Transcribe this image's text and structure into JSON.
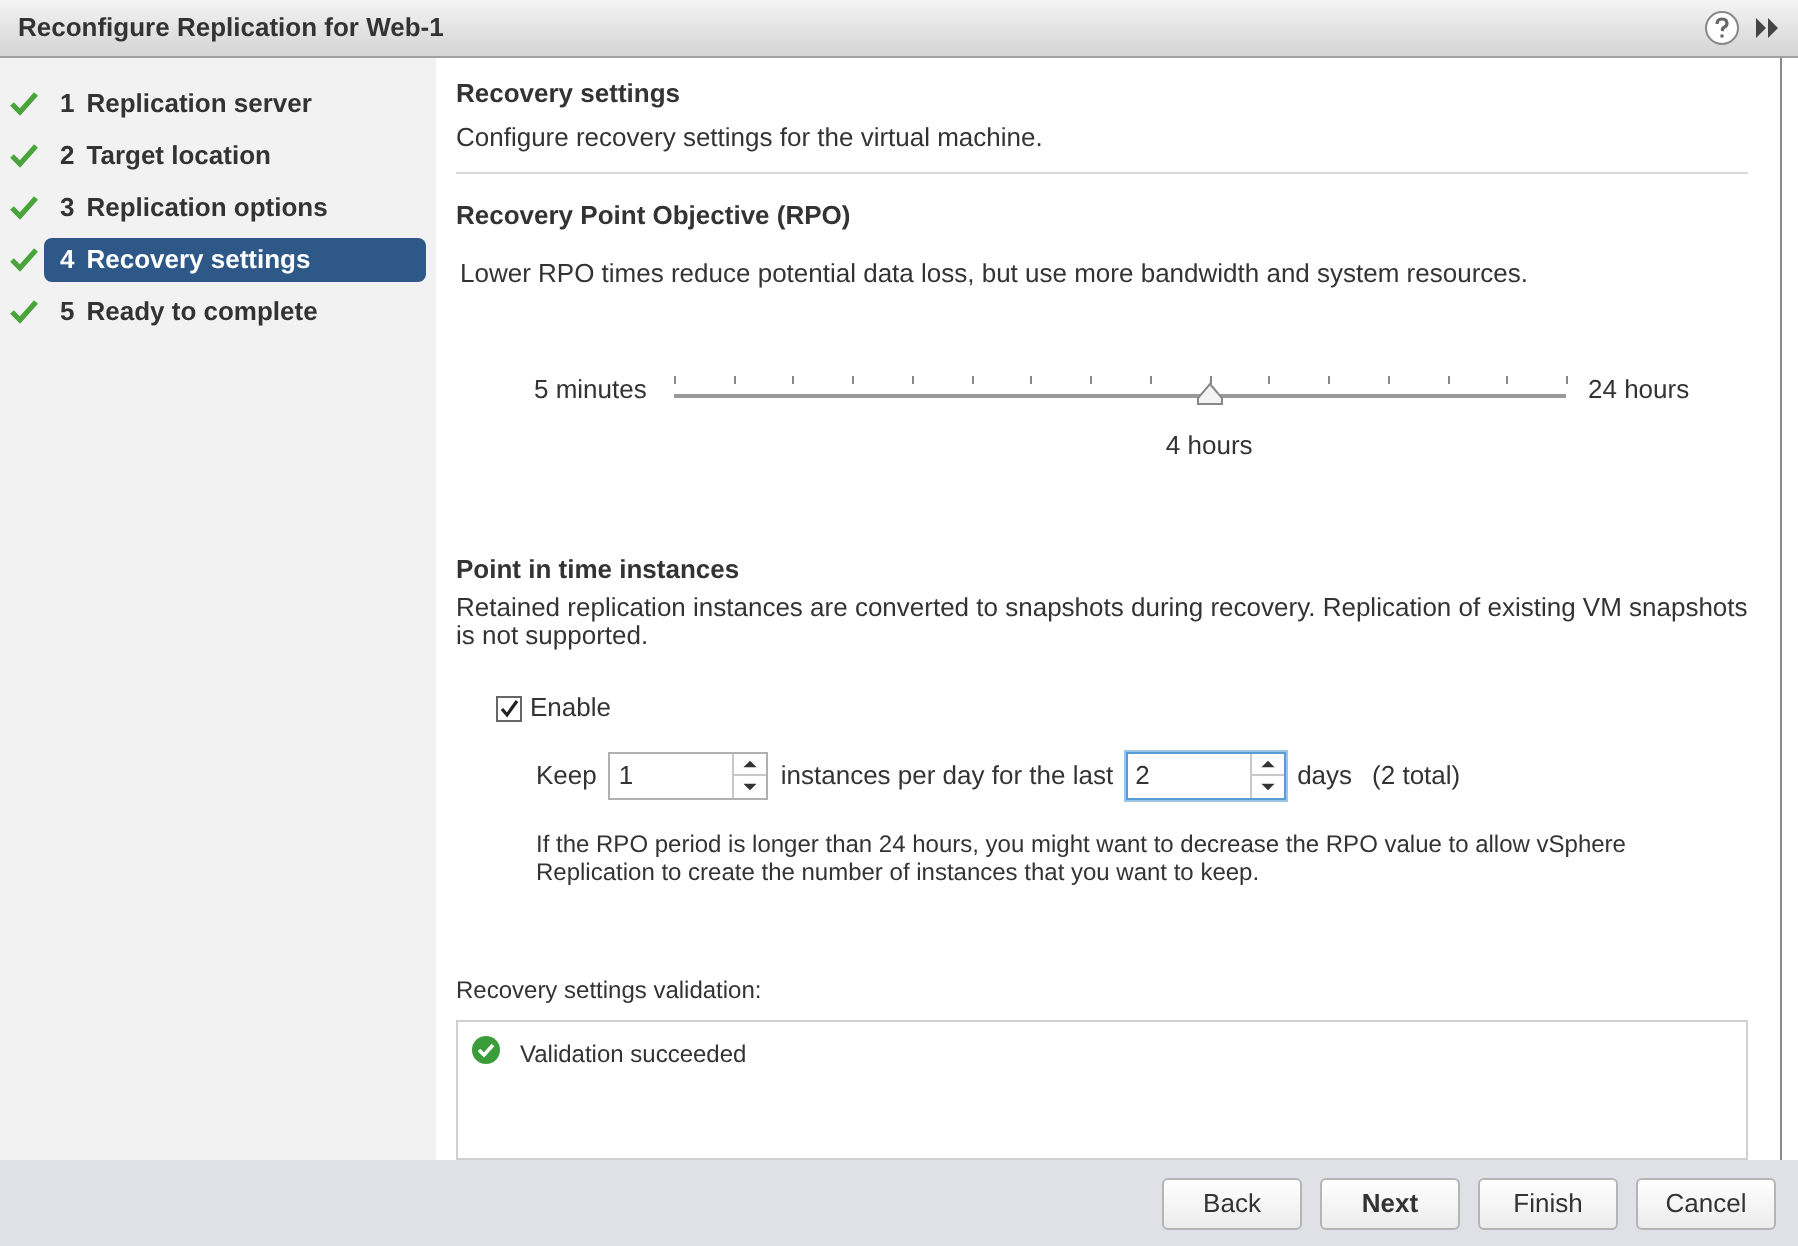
{
  "window": {
    "title": "Reconfigure Replication for Web-1"
  },
  "steps": [
    {
      "number": "1",
      "label": "Replication server",
      "done": true,
      "selected": false
    },
    {
      "number": "2",
      "label": "Target location",
      "done": true,
      "selected": false
    },
    {
      "number": "3",
      "label": "Replication options",
      "done": true,
      "selected": false
    },
    {
      "number": "4",
      "label": "Recovery settings",
      "done": true,
      "selected": true
    },
    {
      "number": "5",
      "label": "Ready to complete",
      "done": true,
      "selected": false
    }
  ],
  "page": {
    "title": "Recovery settings",
    "subtitle": "Configure recovery settings for the virtual machine."
  },
  "rpo": {
    "title": "Recovery Point Objective (RPO)",
    "description": "Lower RPO times reduce potential data loss, but use more bandwidth and system resources.",
    "min_label": "5 minutes",
    "max_label": "24 hours",
    "level": 0.6,
    "value_label": "4 hours"
  },
  "pit": {
    "title": "Point in time instances",
    "description": "Retained replication instances are converted to snapshots during recovery. Replication of existing VM snapshots is not supported.",
    "enable": {
      "label": "Enable",
      "checked": true
    },
    "keep_label": "Keep",
    "instances": {
      "value": "1",
      "focused": false
    },
    "middle_label": "instances per day for the last",
    "days": {
      "value": "2",
      "focused": true
    },
    "days_label": "days",
    "total": "(2 total)",
    "note": "If the RPO period is longer than 24 hours, you might want to decrease the RPO value to allow vSphere Replication to create the number of instances that you want to keep."
  },
  "validation": {
    "label": "Recovery settings validation:",
    "message": "Validation succeeded",
    "success": true
  },
  "buttons": [
    {
      "label": "Back",
      "primary": false
    },
    {
      "label": "Next",
      "primary": true
    },
    {
      "label": "Finish",
      "primary": false
    },
    {
      "label": "Cancel",
      "primary": false
    }
  ]
}
